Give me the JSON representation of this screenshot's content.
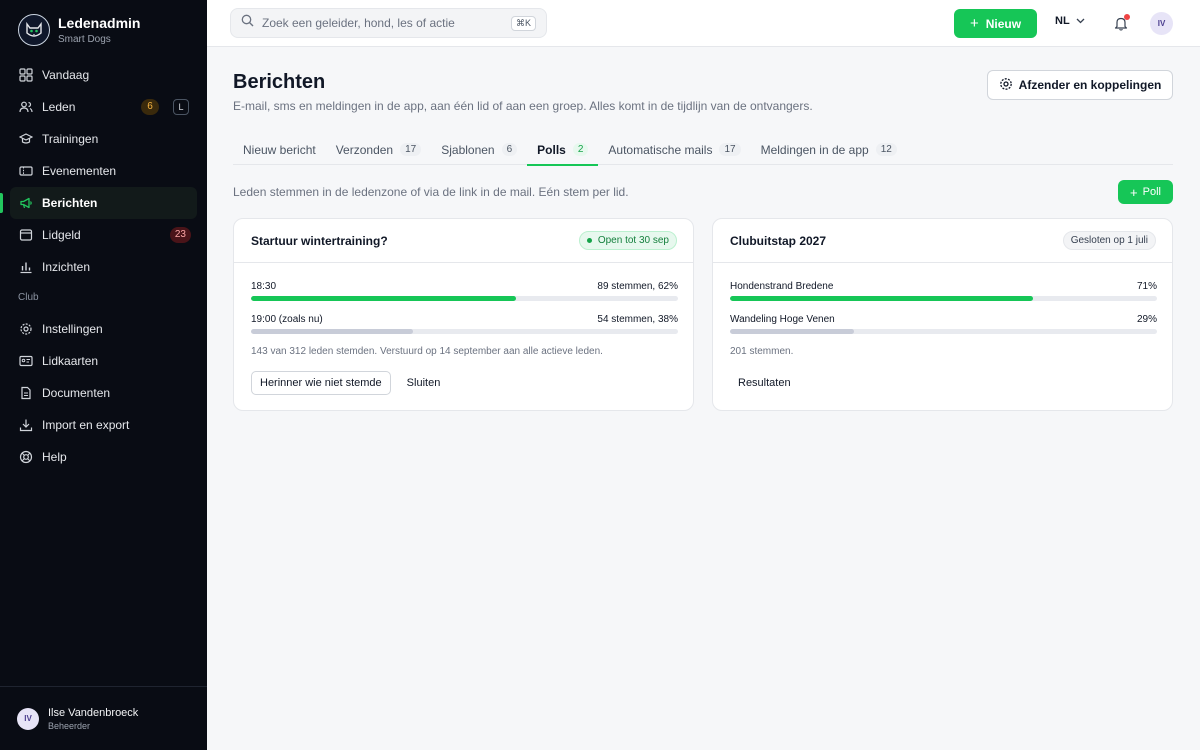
{
  "app": {
    "name": "Ledenadmin",
    "org": "Smart Dogs"
  },
  "sidebar": {
    "items": [
      {
        "label": "Vandaag",
        "icon": "grid-icon"
      },
      {
        "label": "Leden",
        "icon": "users-icon",
        "badge": "6",
        "shortcut": "L"
      },
      {
        "label": "Trainingen",
        "icon": "graduation-cap-icon"
      },
      {
        "label": "Evenementen",
        "icon": "ticket-icon"
      },
      {
        "label": "Berichten",
        "icon": "megaphone-icon",
        "active": true
      },
      {
        "label": "Lidgeld",
        "icon": "wallet-icon",
        "badge": "23"
      },
      {
        "label": "Inzichten",
        "icon": "bar-chart-icon"
      }
    ],
    "section_label": "Club",
    "club_items": [
      {
        "label": "Instellingen",
        "icon": "gear-icon"
      },
      {
        "label": "Lidkaarten",
        "icon": "id-card-icon"
      },
      {
        "label": "Documenten",
        "icon": "document-icon"
      },
      {
        "label": "Import en export",
        "icon": "download-icon"
      },
      {
        "label": "Help",
        "icon": "lifebuoy-icon"
      }
    ],
    "user": {
      "initials": "IV",
      "name": "Ilse Vandenbroeck",
      "role": "Beheerder"
    }
  },
  "topbar": {
    "search_placeholder": "Zoek een geleider, hond, les of actie",
    "search_shortcut": "⌘K",
    "new_label": "Nieuw",
    "language": "NL",
    "user_initials": "IV"
  },
  "page": {
    "title": "Berichten",
    "subtitle": "E-mail, sms en meldingen in de app, aan één lid of aan een groep. Alles komt in de tijdlijn van de ontvangers.",
    "sender_button": "Afzender en koppelingen",
    "tabs": [
      {
        "label": "Nieuw bericht",
        "count": ""
      },
      {
        "label": "Verzonden",
        "count": "17"
      },
      {
        "label": "Sjablonen",
        "count": "6"
      },
      {
        "label": "Polls",
        "count": "2",
        "active": true
      },
      {
        "label": "Automatische mails",
        "count": "17"
      },
      {
        "label": "Meldingen in de app",
        "count": "12"
      }
    ],
    "poll_hint": "Leden stemmen in de ledenzone of via de link in de mail. Eén stem per lid.",
    "poll_button": "Poll"
  },
  "polls": [
    {
      "title": "Startuur wintertraining?",
      "status": "Open tot 30 sep",
      "options": [
        {
          "label": "18:30",
          "result": "89 stemmen, 62%",
          "percent": 62
        },
        {
          "label": "19:00 (zoals nu)",
          "result": "54 stemmen, 38%",
          "percent": 38
        }
      ],
      "meta": "143 van 312 leden stemden. Verstuurd op 14 september aan alle actieve leden.",
      "primary_action": "Herinner wie niet stemde",
      "secondary_action": "Sluiten"
    },
    {
      "title": "Clubuitstap 2027",
      "status": "Gesloten op 1 juli",
      "options": [
        {
          "label": "Hondenstrand Bredene",
          "result": "71%",
          "percent": 71
        },
        {
          "label": "Wandeling Hoge Venen",
          "result": "29%",
          "percent": 29
        }
      ],
      "meta": "201 stemmen.",
      "secondary_action": "Resultaten"
    }
  ],
  "colors": {
    "accent": "#16c657",
    "sidebar_bg": "#090c14",
    "badge_red": "#fca5a5",
    "badge_orange": "#f5b342"
  }
}
